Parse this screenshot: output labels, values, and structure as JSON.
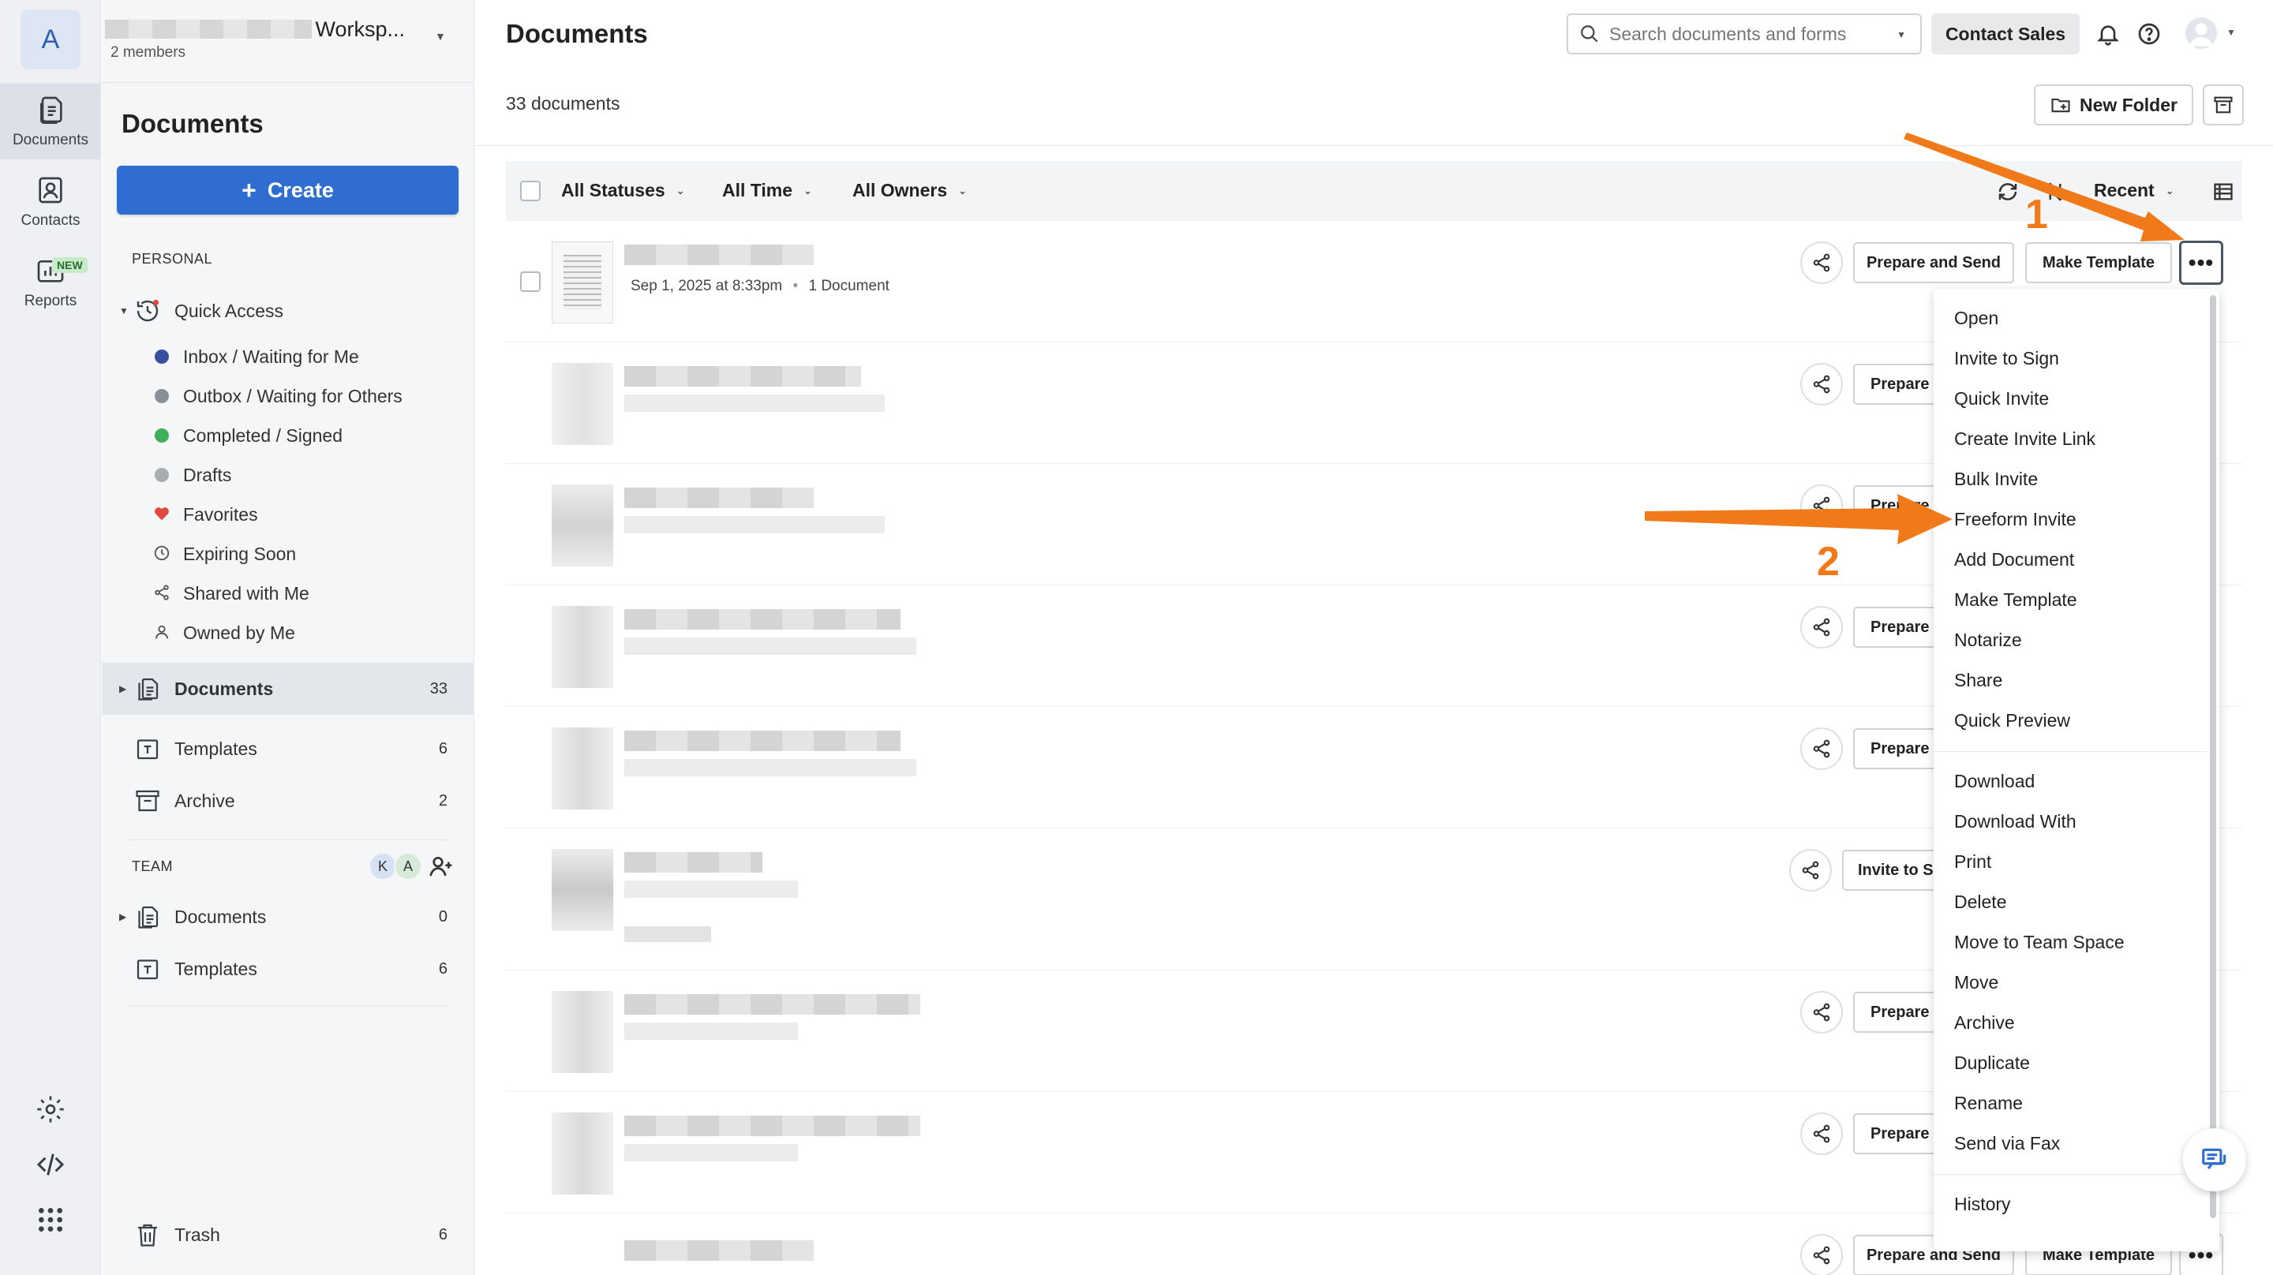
{
  "rail": {
    "logo_letter": "A",
    "items": [
      {
        "label": "Documents",
        "icon": "document-icon"
      },
      {
        "label": "Contacts",
        "icon": "contact-card-icon"
      },
      {
        "label": "Reports",
        "icon": "reports-icon",
        "badge": "NEW"
      }
    ],
    "bottom_icons": [
      "gear-icon",
      "code-icon",
      "apps-grid-icon"
    ]
  },
  "workspace": {
    "name_visible": "Worksp...",
    "members": "2 members"
  },
  "sidebar": {
    "title": "Documents",
    "create_label": "Create",
    "personal_label": "PERSONAL",
    "quick_access_label": "Quick Access",
    "quick_access_items": [
      {
        "label": "Inbox / Waiting for Me",
        "color": "#3b4fa0"
      },
      {
        "label": "Outbox / Waiting for Others",
        "color": "#8a8f96"
      },
      {
        "label": "Completed / Signed",
        "color": "#3fae5a"
      },
      {
        "label": "Drafts",
        "color": "#a9adb3"
      },
      {
        "label": "Favorites",
        "icon": "heart-icon",
        "color": "#e0493f"
      },
      {
        "label": "Expiring Soon",
        "icon": "clock-icon"
      },
      {
        "label": "Shared with Me",
        "icon": "share-icon"
      },
      {
        "label": "Owned by Me",
        "icon": "person-icon"
      }
    ],
    "personal_folders": [
      {
        "label": "Documents",
        "count": "33"
      },
      {
        "label": "Templates",
        "count": "6"
      },
      {
        "label": "Archive",
        "count": "2"
      }
    ],
    "team_label": "TEAM",
    "team_avatars": [
      "K",
      "A"
    ],
    "team_folders": [
      {
        "label": "Documents",
        "count": "0"
      },
      {
        "label": "Templates",
        "count": "6"
      }
    ],
    "trash": {
      "label": "Trash",
      "count": "6"
    }
  },
  "header": {
    "title": "Documents",
    "search_placeholder": "Search documents and forms",
    "contact_sales": "Contact Sales"
  },
  "toolbar": {
    "doc_count": "33 documents",
    "new_folder": "New Folder"
  },
  "filters": {
    "statuses": "All Statuses",
    "time": "All Time",
    "owners": "All Owners",
    "sort": "Recent"
  },
  "rows": {
    "first_meta_date": "Sep 1, 2025 at 8:33pm",
    "first_meta_docs": "1 Document",
    "prepare_and_send": "Prepare and Send",
    "make_template": "Make Template",
    "prepare_short": "Prepare",
    "invite_short": "Invite to S",
    "more": "•••"
  },
  "menu": {
    "group1": [
      "Open",
      "Invite to Sign",
      "Quick Invite",
      "Create Invite Link",
      "Bulk Invite",
      "Freeform Invite",
      "Add Document",
      "Make Template",
      "Notarize",
      "Share",
      "Quick Preview"
    ],
    "group2": [
      "Download",
      "Download With",
      "Print",
      "Delete",
      "Move to Team Space",
      "Move",
      "Archive",
      "Duplicate",
      "Rename",
      "Send via Fax"
    ],
    "group3": [
      "History"
    ]
  },
  "annotations": {
    "step1": "1",
    "step2": "2",
    "arrow_color": "#f07a1a"
  }
}
